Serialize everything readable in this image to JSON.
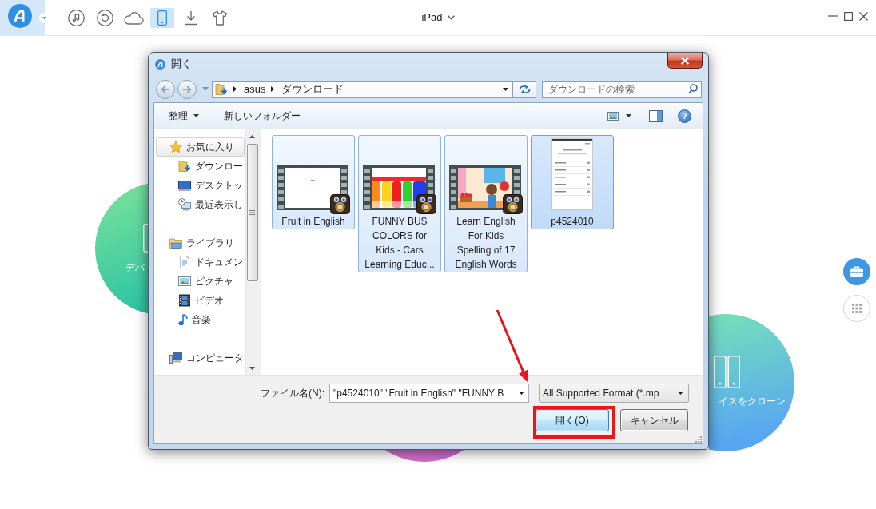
{
  "app_bar": {
    "tools": [
      {
        "selected": false
      },
      {
        "selected": false
      },
      {
        "selected": false
      },
      {
        "selected": true
      },
      {
        "selected": false
      },
      {
        "selected": false
      }
    ],
    "device": "iPad"
  },
  "home": {
    "features": [
      {
        "label": "デバ"
      },
      {
        "label": "イスをクローン"
      }
    ],
    "side_buttons": [
      {
        "selected": true
      },
      {
        "selected": false
      }
    ]
  },
  "dialog": {
    "title": "開く",
    "path": [
      "asus",
      "ダウンロード"
    ],
    "search": {
      "placeholder": "ダウンロードの検索"
    },
    "toolbar": {
      "organize": "整理",
      "new_folder": "新しいフォルダー",
      "help": "?"
    },
    "nav": [
      {
        "label": "お気に入り",
        "selected": true,
        "children": [
          {
            "label": "ダウンロー",
            "selected": false
          },
          {
            "label": "デスクトッ",
            "selected": false
          },
          {
            "label": "最近表示し",
            "selected": false
          }
        ]
      },
      {
        "label": "ライブラリ",
        "selected": false,
        "children": [
          {
            "label": "ドキュメン",
            "selected": false
          },
          {
            "label": "ピクチャ",
            "selected": false
          },
          {
            "label": "ビデオ",
            "selected": false
          },
          {
            "label": "音楽",
            "selected": false
          }
        ]
      },
      {
        "label": "コンピュータ",
        "selected": false
      }
    ],
    "files": [
      {
        "name": "Fruit in English",
        "kind": "video",
        "selected": true,
        "focused": false
      },
      {
        "name": "FUNNY BUS COLORS for Kids - Cars Learning Educ...",
        "kind": "video",
        "selected": true,
        "focused": false
      },
      {
        "name": "Learn English For Kids Spelling of 17 English Words",
        "kind": "video",
        "selected": true,
        "focused": false
      },
      {
        "name": "p4524010",
        "kind": "image",
        "selected": true,
        "focused": true
      }
    ],
    "file_name": {
      "label": "ファイル名(N):",
      "value": "\"p4524010\" \"Fruit in English\" \"FUNNY B"
    },
    "file_type": {
      "value": "All Supported Format (*.mp"
    },
    "buttons": [
      {
        "label": "開く(O)",
        "default": true
      },
      {
        "label": "キャンセル",
        "default": false
      }
    ]
  }
}
